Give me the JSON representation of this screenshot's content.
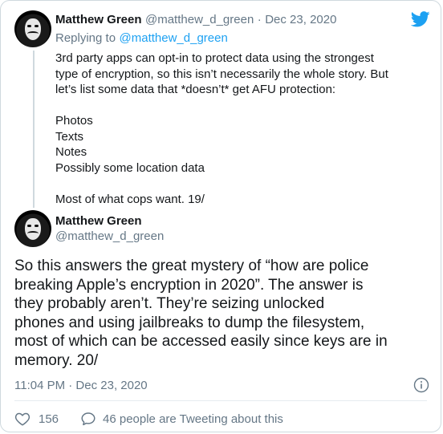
{
  "reply_tweet": {
    "author_name": "Matthew Green",
    "author_handle": "@matthew_d_green",
    "separator": "·",
    "date": "Dec 23, 2020",
    "replying_prefix": "Replying to",
    "replying_to": "@matthew_d_green",
    "lines": [
      "3rd party apps can opt-in to protect data using the strongest",
      "type of encryption, so this isn’t necessarily the whole story. But",
      "let’s list some data that *doesn’t* get AFU protection:",
      "",
      "Photos",
      "Texts",
      "Notes",
      "Possibly some location data",
      "",
      "Most of what cops want. 19/"
    ]
  },
  "main_tweet": {
    "author_name": "Matthew Green",
    "author_handle": "@matthew_d_green",
    "lines": [
      "So this answers the great mystery of “how are police",
      "breaking Apple’s encryption in 2020”. The answer is",
      "they probably aren’t. They’re seizing unlocked",
      "phones and using jailbreaks to dump the filesystem,",
      "most of which can be accessed easily since keys are in",
      "memory. 20/"
    ],
    "timestamp": "11:04 PM · Dec 23, 2020",
    "likes": "156",
    "conversation_label": "46 people are Tweeting about this"
  },
  "colors": {
    "brand": "#1da1f2",
    "muted": "#657786",
    "text": "#14171a",
    "border": "#cfd9de"
  },
  "icons": {
    "logo": "twitter-bird-icon",
    "info": "info-icon",
    "like": "heart-icon",
    "reply": "speech-bubble-icon"
  }
}
